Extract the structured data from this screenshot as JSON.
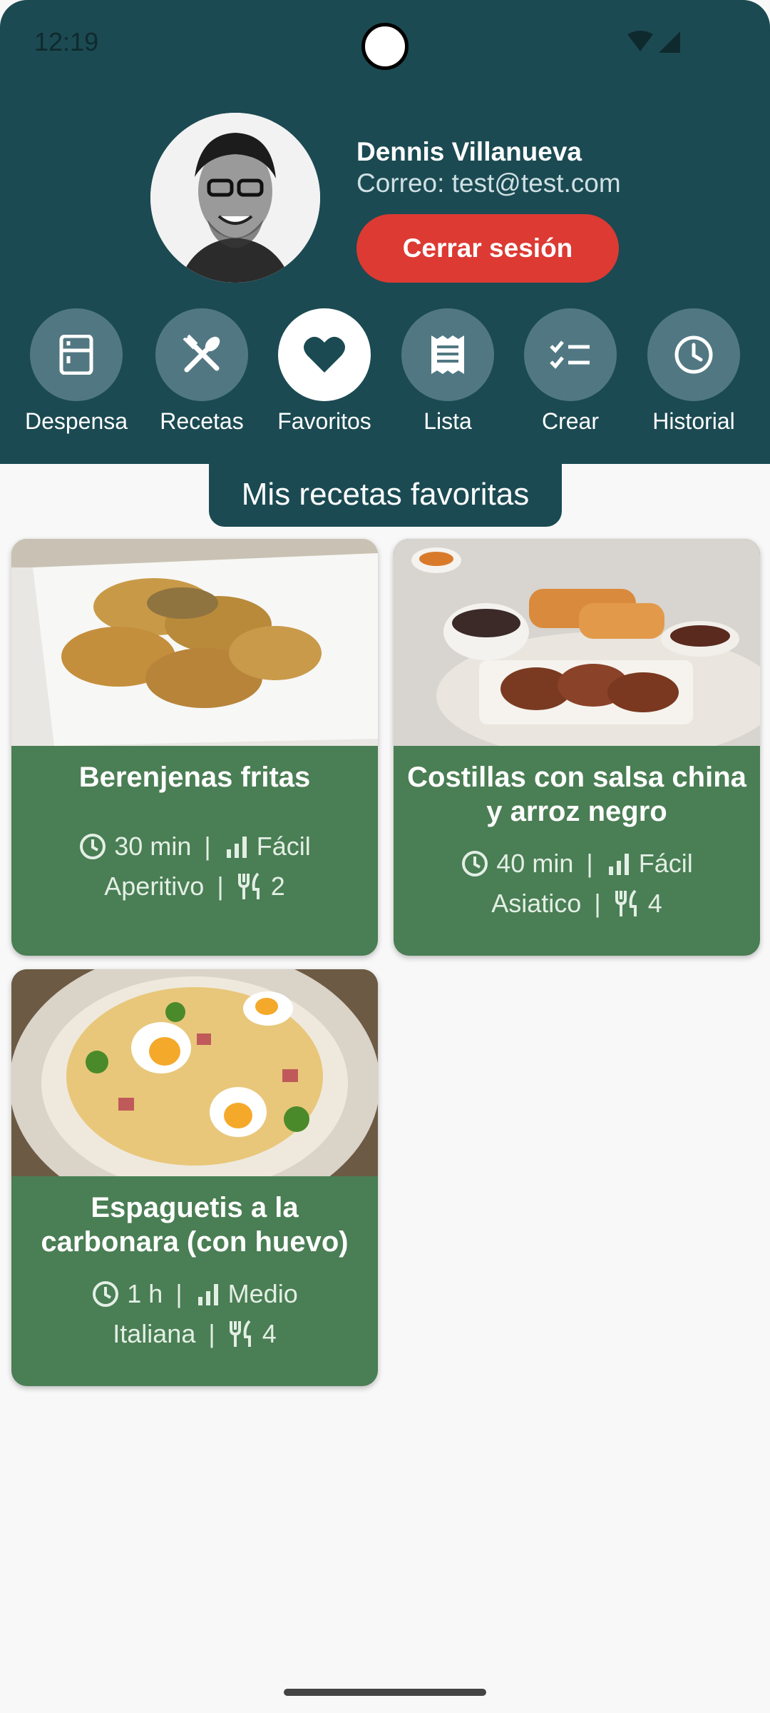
{
  "status_bar": {
    "time": "12:19"
  },
  "profile": {
    "name": "Dennis Villanueva",
    "email": "Correo: test@test.com",
    "logout_label": "Cerrar sesión"
  },
  "nav": [
    {
      "label": "Despensa",
      "icon": "fridge-icon",
      "active": false
    },
    {
      "label": "Recetas",
      "icon": "utensils-cross-icon",
      "active": false
    },
    {
      "label": "Favoritos",
      "icon": "heart-icon",
      "active": true
    },
    {
      "label": "Lista",
      "icon": "receipt-list-icon",
      "active": false
    },
    {
      "label": "Crear",
      "icon": "checklist-icon",
      "active": false
    },
    {
      "label": "Historial",
      "icon": "clock-icon",
      "active": false
    }
  ],
  "section_title": "Mis recetas favoritas",
  "recipes": [
    {
      "title": "Berenjenas fritas",
      "time": "30 min",
      "difficulty": "Fácil",
      "category": "Aperitivo",
      "servings": "2"
    },
    {
      "title": "Costillas con salsa china y arroz negro",
      "time": "40 min",
      "difficulty": "Fácil",
      "category": "Asiatico",
      "servings": "4"
    },
    {
      "title": "Espaguetis a la carbonara (con huevo)",
      "time": "1 h",
      "difficulty": "Medio",
      "category": "Italiana",
      "servings": "4"
    }
  ],
  "colors": {
    "header": "#1b4a52",
    "card": "#4a7e54",
    "logout": "#dc3a33",
    "nav_circle": "#517882"
  }
}
